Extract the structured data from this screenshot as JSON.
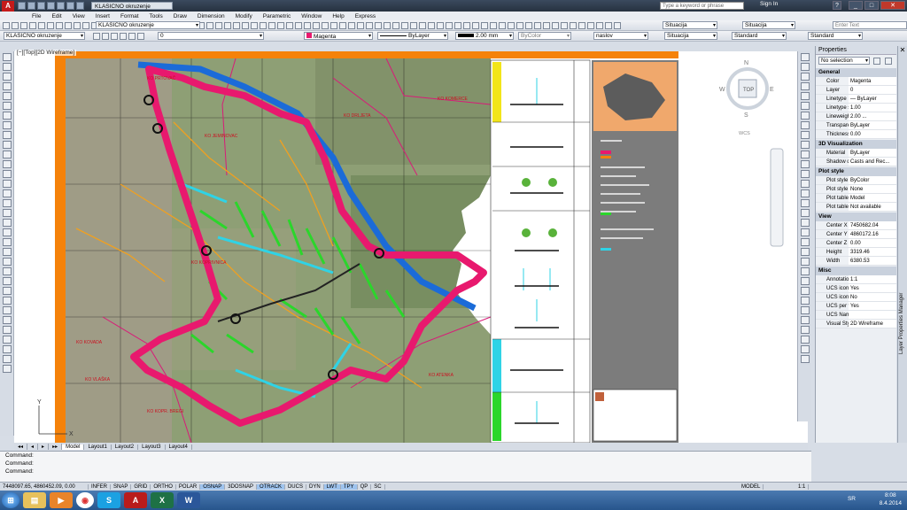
{
  "app": {
    "doc_title": "KLASICNO okruzenje",
    "search_placeholder": "Type a keyword or phrase",
    "signin": "Sign In",
    "help": "?",
    "win_min": "_",
    "win_max": "□",
    "win_close": "✕"
  },
  "menu": [
    "File",
    "Edit",
    "View",
    "Insert",
    "Format",
    "Tools",
    "Draw",
    "Dimension",
    "Modify",
    "Parametric",
    "Window",
    "Help",
    "Express"
  ],
  "toolbar": {
    "workspace": "KLASICNO okruzenje",
    "layer": "0",
    "color": "Magenta",
    "linetype": "ByLayer",
    "lineweight": "2.00 mm",
    "plotstyle": "ByColor",
    "textstyle": "naslov",
    "dimstyle": "Situacija",
    "tablestyle": "Standard",
    "mleaderstyle": "Standard",
    "annot_scale": "Situacija",
    "text_input": "Enter Text"
  },
  "viewport": {
    "label": "[−][Top][2D Wireframe]",
    "viewcube": {
      "n": "N",
      "s": "S",
      "e": "E",
      "w": "W",
      "top": "TOP",
      "wcs": "WCS"
    },
    "ucs_y": "Y",
    "ucs_x": "X",
    "map_labels": [
      "KO KOMERCE",
      "KO DRLJETA",
      "KO JEMINOVAC",
      "KO PRTOVAČ",
      "KO VLAŠKA",
      "KO KOPRIVNICA",
      "KO ATENKA",
      "KO KOPR. BREGI",
      "KO KOVADA"
    ]
  },
  "properties": {
    "title": "Properties",
    "selection": "No selection",
    "sections": [
      {
        "name": "General",
        "rows": [
          [
            "Color",
            "Magenta"
          ],
          [
            "Layer",
            "0"
          ],
          [
            "Linetype",
            "— ByLayer"
          ],
          [
            "Linetype s...",
            "1.00"
          ],
          [
            "Lineweight",
            "2.00 ..."
          ],
          [
            "Transpare...",
            "ByLayer"
          ],
          [
            "Thickness",
            "0.00"
          ]
        ]
      },
      {
        "name": "3D Visualization",
        "rows": [
          [
            "Material",
            "ByLayer"
          ],
          [
            "Shadow d...",
            "Casts and Rec..."
          ]
        ]
      },
      {
        "name": "Plot style",
        "rows": [
          [
            "Plot style",
            "ByColor"
          ],
          [
            "Plot style ...",
            "None"
          ],
          [
            "Plot table ...",
            "Model"
          ],
          [
            "Plot table ...",
            "Not available"
          ]
        ]
      },
      {
        "name": "View",
        "rows": [
          [
            "Center X",
            "7450682.04"
          ],
          [
            "Center Y",
            "4860172.16"
          ],
          [
            "Center Z",
            "0.00"
          ],
          [
            "Height",
            "3319.46"
          ],
          [
            "Width",
            "6380.53"
          ]
        ]
      },
      {
        "name": "Misc",
        "rows": [
          [
            "Annotatio...",
            "1:1"
          ],
          [
            "UCS icon ...",
            "Yes"
          ],
          [
            "UCS icon ...",
            "No"
          ],
          [
            "UCS per v...",
            "Yes"
          ],
          [
            "UCS Name",
            ""
          ],
          [
            "Visual Style",
            "2D Wireframe"
          ]
        ]
      }
    ],
    "side_label": "Layer Properties Manager"
  },
  "tabs": [
    "Model",
    "Layout1",
    "Layout2",
    "Layout3",
    "Layout4"
  ],
  "command_lines": [
    "Command:",
    "Command:",
    "Command:"
  ],
  "status": {
    "coords": "7448097.65, 4860452.09, 0.00",
    "buttons": [
      "INFER",
      "SNAP",
      "GRID",
      "ORTHO",
      "POLAR",
      "OSNAP",
      "3DOSNAP",
      "OTRACK",
      "DUCS",
      "DYN",
      "LWT",
      "TPY",
      "QP",
      "SC"
    ],
    "on_buttons": [
      "OSNAP",
      "OTRACK",
      "LWT",
      "TPY"
    ],
    "model": "MODEL",
    "scale": "1:1"
  },
  "taskbar": {
    "lang": "SR",
    "time": "8:08",
    "date": "8.4.2014"
  },
  "colors": {
    "magenta": "#e8196e",
    "green": "#2bd62b",
    "cyan": "#2fd3e6",
    "orange": "#f5820a",
    "blue": "#1b6bd8"
  }
}
